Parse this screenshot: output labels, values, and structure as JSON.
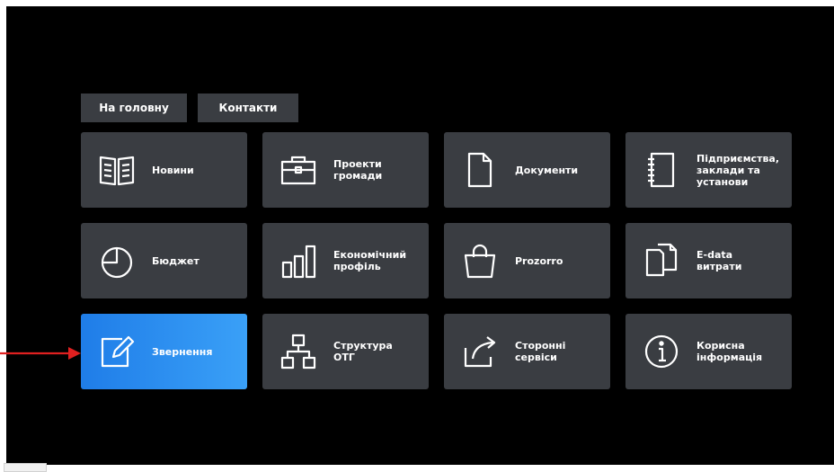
{
  "nav": {
    "home": "На головну",
    "contacts": "Контакти"
  },
  "tiles": [
    {
      "label": "Новини",
      "icon": "book-icon"
    },
    {
      "label": "Проекти\nгромади",
      "icon": "briefcase-icon"
    },
    {
      "label": "Документи",
      "icon": "document-icon"
    },
    {
      "label": "Підприємства,\nзаклади та\nустанови",
      "icon": "notebook-icon"
    },
    {
      "label": "Бюджет",
      "icon": "pie-chart-icon"
    },
    {
      "label": "Економічний\nпрофіль",
      "icon": "bar-chart-icon"
    },
    {
      "label": "Prozorro",
      "icon": "shopping-bag-icon"
    },
    {
      "label": "E-data\nвитрати",
      "icon": "files-icon"
    },
    {
      "label": "Звернення",
      "icon": "edit-icon",
      "active": true
    },
    {
      "label": "Структура\nОТГ",
      "icon": "org-structure-icon"
    },
    {
      "label": "Сторонні\nсервіси",
      "icon": "share-icon"
    },
    {
      "label": "Корисна\nінформація",
      "icon": "info-icon"
    }
  ],
  "colors": {
    "background": "#000000",
    "tile": "#3a3d42",
    "active_tile_start": "#1f7de8",
    "active_tile_end": "#3aa0f7",
    "arrow": "#e02020"
  }
}
